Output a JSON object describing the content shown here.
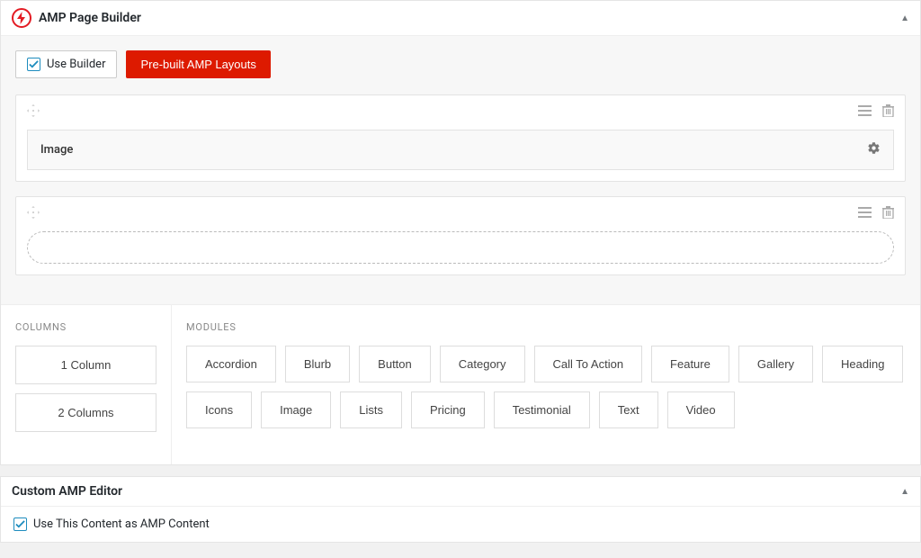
{
  "panels": {
    "builder": {
      "title": "AMP Page Builder"
    },
    "editor": {
      "title": "Custom AMP Editor"
    }
  },
  "toolbar": {
    "use_builder": {
      "label": "Use Builder",
      "checked": true
    },
    "prebuilt": {
      "label": "Pre-built AMP Layouts"
    }
  },
  "rows": {
    "first_module": {
      "label": "Image"
    }
  },
  "sections": {
    "columns_label": "COLUMNS",
    "modules_label": "MODULES"
  },
  "columns": [
    {
      "label": "1 Column"
    },
    {
      "label": "2 Columns"
    }
  ],
  "modules": [
    {
      "label": "Accordion"
    },
    {
      "label": "Blurb"
    },
    {
      "label": "Button"
    },
    {
      "label": "Category"
    },
    {
      "label": "Call To Action"
    },
    {
      "label": "Feature"
    },
    {
      "label": "Gallery"
    },
    {
      "label": "Heading"
    },
    {
      "label": "Icons"
    },
    {
      "label": "Image"
    },
    {
      "label": "Lists"
    },
    {
      "label": "Pricing"
    },
    {
      "label": "Testimonial"
    },
    {
      "label": "Text"
    },
    {
      "label": "Video"
    }
  ],
  "editor_checkbox": {
    "label": "Use This Content as AMP Content",
    "checked": true
  }
}
